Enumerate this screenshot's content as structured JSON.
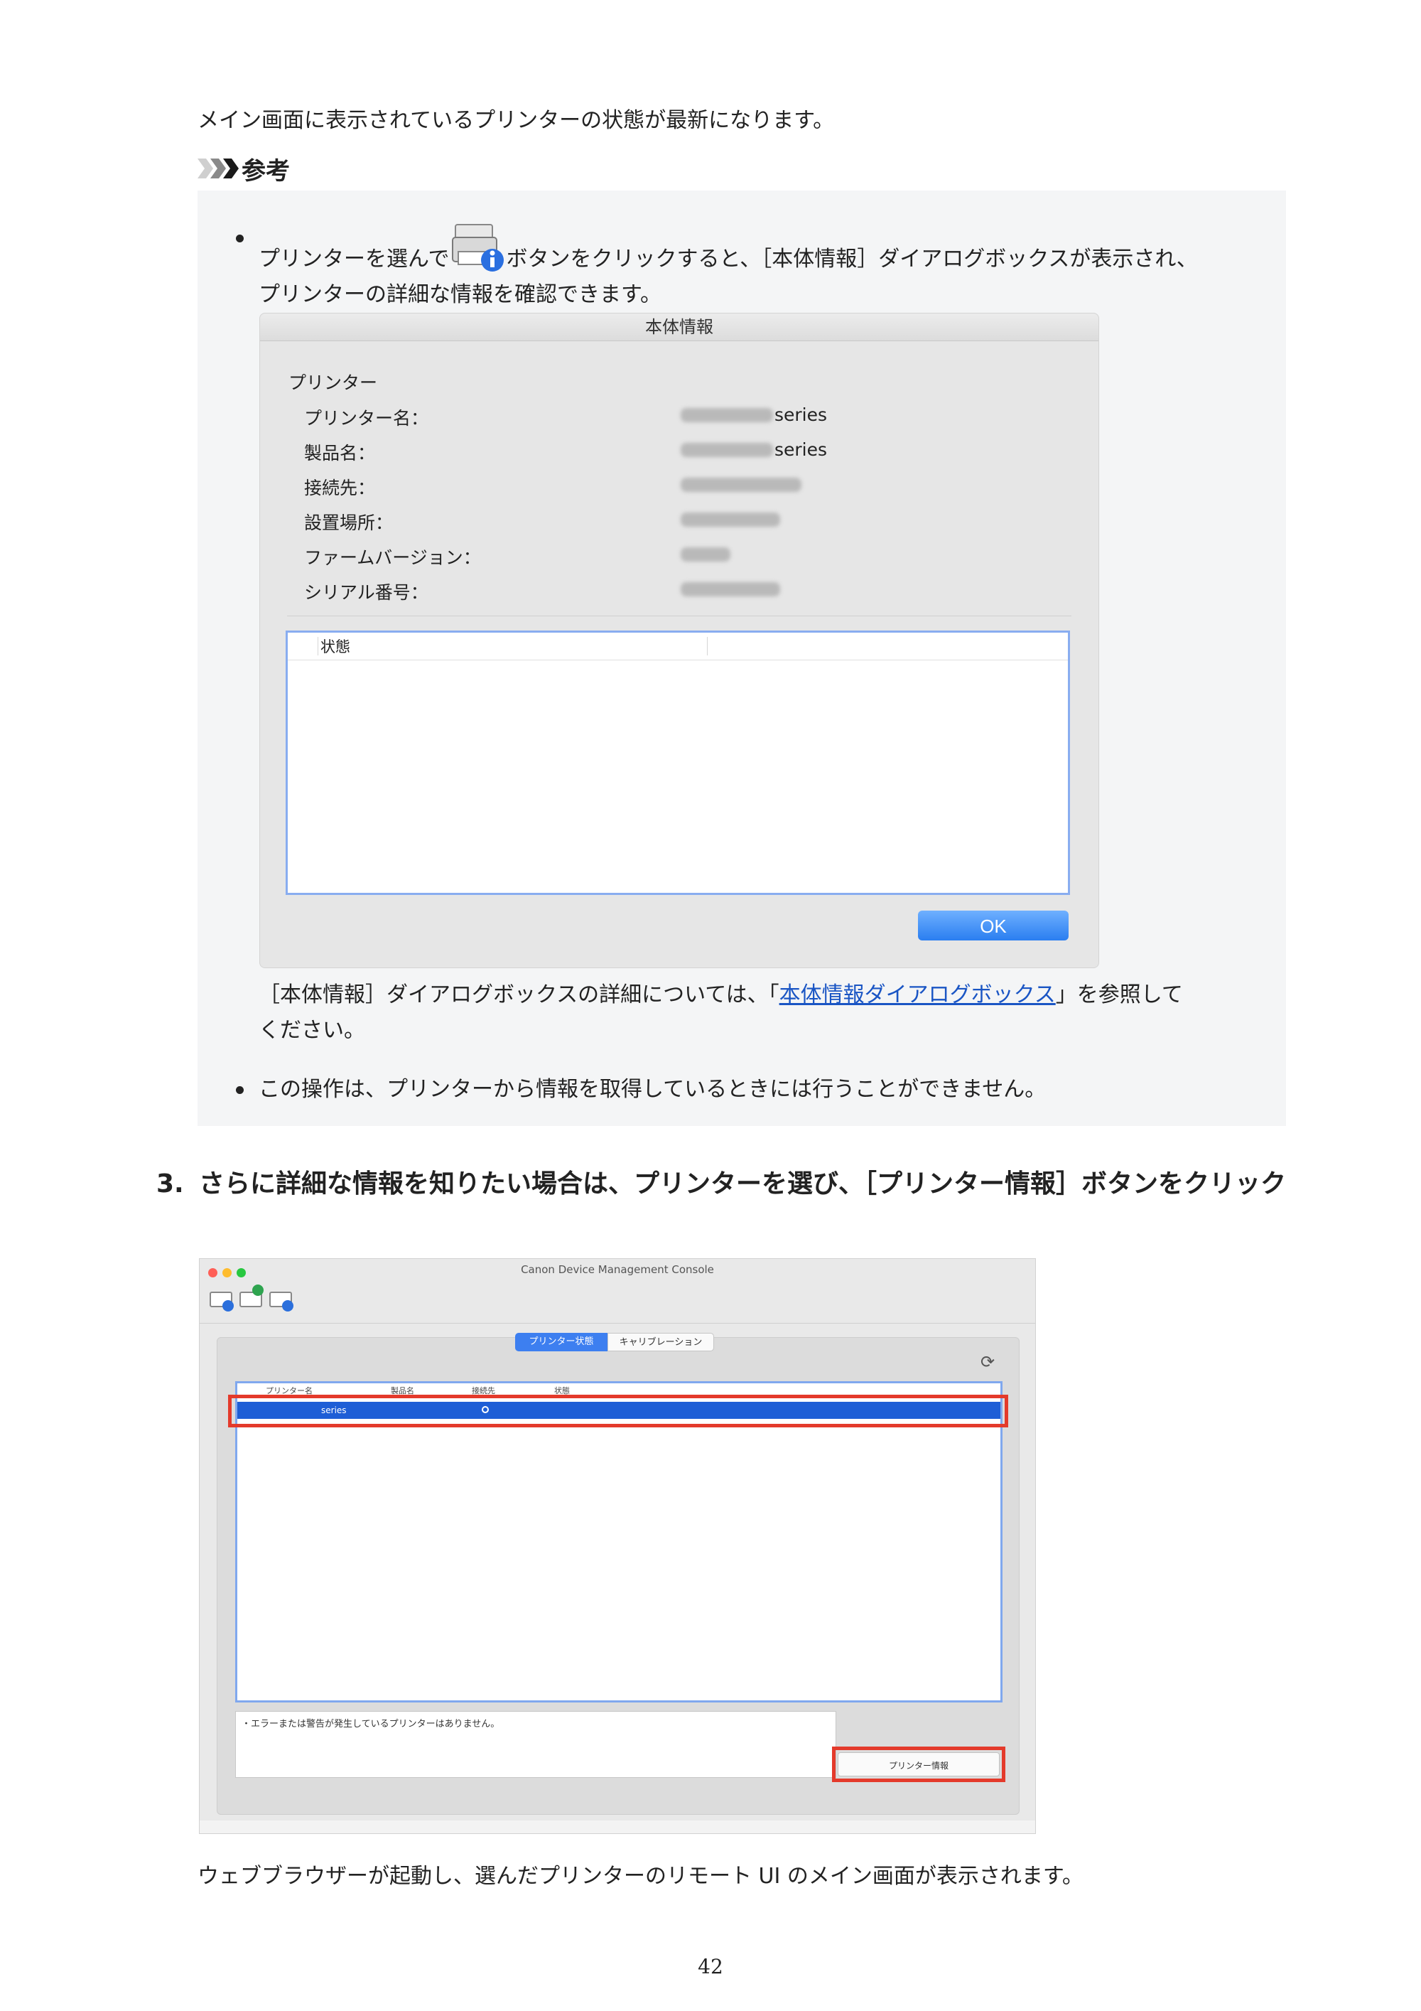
{
  "intro_text": "メイン画面に表示されているプリンターの状態が最新になります。",
  "note": {
    "heading": "参考",
    "bullet1_pre": "プリンターを選んで",
    "bullet1_post": "ボタンをクリックすると、［本体情報］ダイアログボックスが表示され、",
    "bullet1_line2": "プリンターの詳細な情報を確認できます。",
    "ref_pre": "［本体情報］ダイアログボックスの詳細については、「",
    "ref_link": "本体情報ダイアログボックス",
    "ref_post": "」を参照して",
    "ref_line2": "ください。",
    "bullet2": "この操作は、プリンターから情報を取得しているときには行うことができません。"
  },
  "dialog": {
    "title": "本体情報",
    "section": "プリンター",
    "rows": [
      {
        "label": "プリンター名：",
        "value": "series"
      },
      {
        "label": "製品名：",
        "value": "series"
      },
      {
        "label": "接続先：",
        "value": ""
      },
      {
        "label": "設置場所：",
        "value": ""
      },
      {
        "label": "ファームバージョン：",
        "value": ""
      },
      {
        "label": "シリアル番号：",
        "value": ""
      }
    ],
    "status_header": "状態",
    "ok_label": "OK"
  },
  "step3": {
    "number": "3.",
    "text": "さらに詳細な情報を知りたい場合は、プリンターを選び、［プリンター情報］ボタンをクリック"
  },
  "console": {
    "title": "Canon Device Management Console",
    "tab_status": "プリンター状態",
    "tab_calibration": "キャリブレーション",
    "col_printer": "プリンター名",
    "col_product": "製品名",
    "col_connection": "接続先",
    "col_status": "状態",
    "row_series": "series",
    "message": "・エラーまたは警告が発生しているプリンターはありません。",
    "printer_info_button": "プリンター情報",
    "colors": {
      "red_highlight": "#e43a2b",
      "selection": "#1e5ed6"
    }
  },
  "outro_text": "ウェブブラウザーが起動し、選んだプリンターのリモート UI のメイン画面が表示されます。",
  "page_number": "42"
}
